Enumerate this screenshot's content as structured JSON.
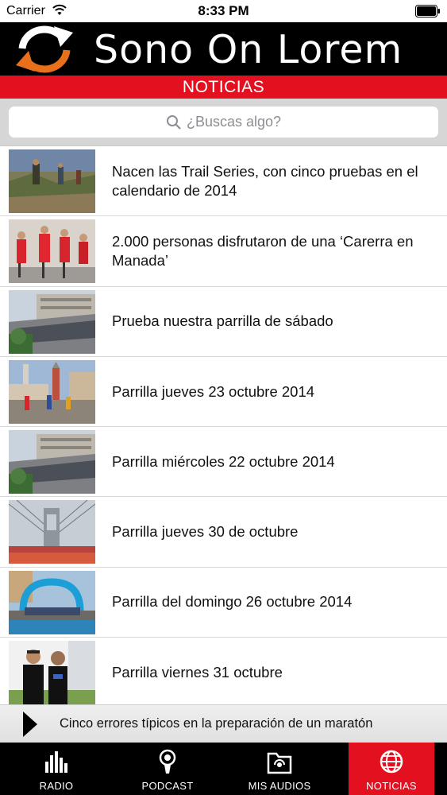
{
  "status_bar": {
    "carrier": "Carrier",
    "time": "8:33 PM"
  },
  "header": {
    "title": "Sono On Lorem",
    "logo_icon": "refresh-arrows-icon",
    "accent_color": "#e3101f"
  },
  "section": {
    "title": "NOTICIAS"
  },
  "search": {
    "placeholder": "¿Buscas algo?"
  },
  "news": [
    {
      "title": "Nacen las Trail Series, con cinco pruebas en el calendario de 2014",
      "thumb": "trail-runners-photo"
    },
    {
      "title": "2.000 personas disfrutaron de una ‘Carerra en Manada’",
      "thumb": "runners-red-shirts-photo"
    },
    {
      "title": "Prueba nuestra parrilla de sábado",
      "thumb": "marathon-crowd-building-photo"
    },
    {
      "title": "Parrilla jueves 23 octubre 2014",
      "thumb": "venice-marathon-photo"
    },
    {
      "title": "Parrilla miércoles 22 octubre 2014",
      "thumb": "marathon-crowd-building-photo"
    },
    {
      "title": "Parrilla jueves 30 de octubre",
      "thumb": "bridge-marathon-photo"
    },
    {
      "title": "Parrilla del domingo 26 octubre 2014",
      "thumb": "marathon-start-arch-photo"
    },
    {
      "title": "Parrilla viernes 31 octubre",
      "thumb": "two-women-runners-photo"
    }
  ],
  "now_playing": {
    "title": "Cinco errores típicos en la preparación de un maratón"
  },
  "tabs": [
    {
      "label": "RADIO",
      "icon": "equalizer-icon",
      "active": false
    },
    {
      "label": "PODCAST",
      "icon": "podcast-icon",
      "active": false
    },
    {
      "label": "MIS AUDIOS",
      "icon": "folder-audio-icon",
      "active": false
    },
    {
      "label": "NOTICIAS",
      "icon": "globe-icon",
      "active": true
    }
  ]
}
